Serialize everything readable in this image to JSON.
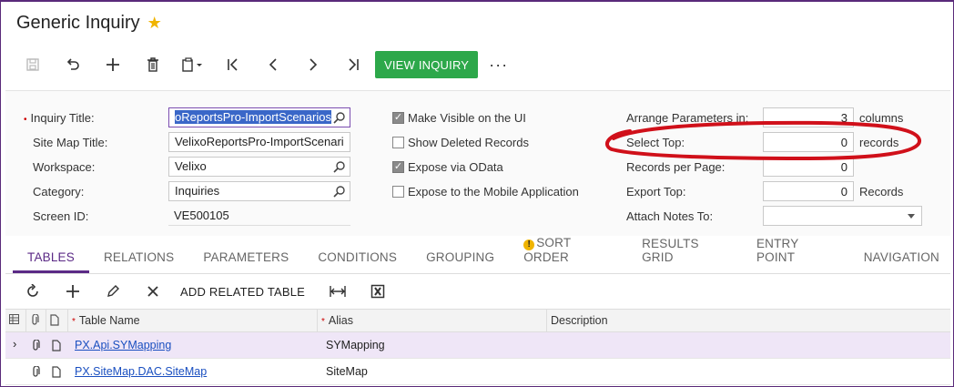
{
  "header": {
    "title": "Generic Inquiry"
  },
  "toolbar": {
    "view_inquiry": "VIEW INQUIRY",
    "more": "···"
  },
  "form": {
    "inquiry_title_label": "Inquiry Title:",
    "inquiry_title_value": "oReportsPro-ImportScenarios",
    "site_map_title_label": "Site Map Title:",
    "site_map_title_value": "VelixoReportsPro-ImportScenari",
    "workspace_label": "Workspace:",
    "workspace_value": "Velixo",
    "category_label": "Category:",
    "category_value": "Inquiries",
    "screen_id_label": "Screen ID:",
    "screen_id_value": "VE500105",
    "make_visible_label": "Make Visible on the UI",
    "make_visible_checked": true,
    "show_deleted_label": "Show Deleted Records",
    "show_deleted_checked": false,
    "expose_odata_label": "Expose via OData",
    "expose_odata_checked": true,
    "expose_mobile_label": "Expose to the Mobile Application",
    "expose_mobile_checked": false,
    "arrange_params_label": "Arrange Parameters in:",
    "arrange_params_value": "3",
    "arrange_params_unit": "columns",
    "select_top_label": "Select Top:",
    "select_top_value": "0",
    "select_top_unit": "records",
    "records_per_page_label": "Records per Page:",
    "records_per_page_value": "0",
    "export_top_label": "Export Top:",
    "export_top_value": "0",
    "export_top_unit": "Records",
    "attach_notes_label": "Attach Notes To:",
    "attach_notes_value": ""
  },
  "tabs": [
    {
      "label": "TABLES",
      "active": true
    },
    {
      "label": "RELATIONS"
    },
    {
      "label": "PARAMETERS"
    },
    {
      "label": "CONDITIONS"
    },
    {
      "label": "GROUPING"
    },
    {
      "label": "SORT ORDER",
      "warning": true
    },
    {
      "label": "RESULTS GRID"
    },
    {
      "label": "ENTRY POINT"
    },
    {
      "label": "NAVIGATION"
    }
  ],
  "grid_toolbar": {
    "add_related_table": "ADD RELATED TABLE"
  },
  "grid": {
    "columns": {
      "table_name": "Table Name",
      "alias": "Alias",
      "description": "Description"
    },
    "rows": [
      {
        "table_name": "PX.Api.SYMapping",
        "alias": "SYMapping",
        "description": ""
      },
      {
        "table_name": "PX.SiteMap.DAC.SiteMap",
        "alias": "SiteMap",
        "description": ""
      }
    ]
  },
  "colors": {
    "accent": "#5b2a86",
    "primary_button": "#2da84a",
    "annotation": "#d0101a",
    "link": "#1a4fc0"
  }
}
